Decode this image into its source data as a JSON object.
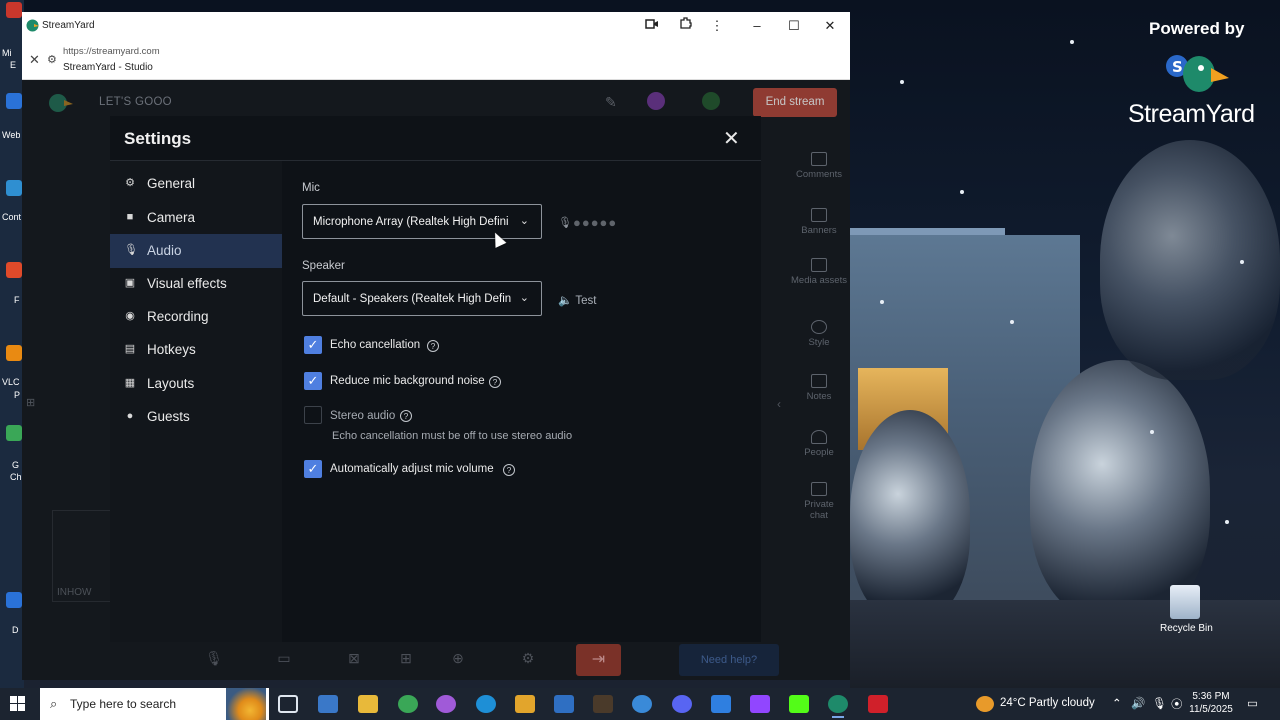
{
  "browser": {
    "window_title": "StreamYard",
    "url": "https://streamyard.com",
    "page_title": "StreamYard - Studio"
  },
  "studio": {
    "broadcast_name": "LET'S GOOO",
    "end_stream_label": "End stream",
    "preview_name": "INHOW",
    "need_help_label": "Need help?",
    "rail": [
      {
        "label": "Comments",
        "icon": "comment-icon"
      },
      {
        "label": "Banners",
        "icon": "banner-icon"
      },
      {
        "label": "Media assets",
        "icon": "media-icon"
      },
      {
        "label": "Style",
        "icon": "palette-icon"
      },
      {
        "label": "Notes",
        "icon": "notes-icon"
      },
      {
        "label": "People",
        "icon": "people-icon"
      },
      {
        "label": "Private chat",
        "icon": "chat-icon"
      }
    ]
  },
  "settings": {
    "title": "Settings",
    "nav": [
      {
        "label": "General",
        "icon": "gear-icon"
      },
      {
        "label": "Camera",
        "icon": "camera-icon"
      },
      {
        "label": "Audio",
        "icon": "mic-icon",
        "active": true
      },
      {
        "label": "Visual effects",
        "icon": "person-frame-icon"
      },
      {
        "label": "Recording",
        "icon": "record-icon"
      },
      {
        "label": "Hotkeys",
        "icon": "keyboard-icon"
      },
      {
        "label": "Layouts",
        "icon": "layout-icon"
      },
      {
        "label": "Guests",
        "icon": "person-icon"
      }
    ],
    "mic_label": "Mic",
    "mic_value": "Microphone Array (Realtek High Defini",
    "speaker_label": "Speaker",
    "speaker_value": "Default - Speakers (Realtek High Defin",
    "test_label": "Test",
    "options": {
      "echo_cancellation": {
        "label": "Echo cancellation",
        "checked": true
      },
      "reduce_noise": {
        "label": "Reduce mic background noise",
        "checked": true
      },
      "stereo_audio": {
        "label": "Stereo audio",
        "checked": false,
        "hint": "Echo cancellation must be off to use stereo audio"
      },
      "auto_adjust": {
        "label": "Automatically adjust mic volume",
        "checked": true
      }
    }
  },
  "desktop": {
    "powered_by": "Powered by",
    "brand": "StreamYard",
    "recycle_bin": "Recycle Bin",
    "left_labels": [
      "Mi",
      "E",
      "Web",
      "Cont",
      "F",
      "VLC",
      "P",
      "G",
      "Ch",
      "D"
    ]
  },
  "taskbar": {
    "search_placeholder": "Type here to search",
    "weather": "24°C  Partly cloudy",
    "time": "5:36 PM",
    "date": "11/5/2025"
  },
  "colors": {
    "accent": "#4f7fe0",
    "active_nav": "#223250",
    "end_stream": "#8f3b32"
  }
}
